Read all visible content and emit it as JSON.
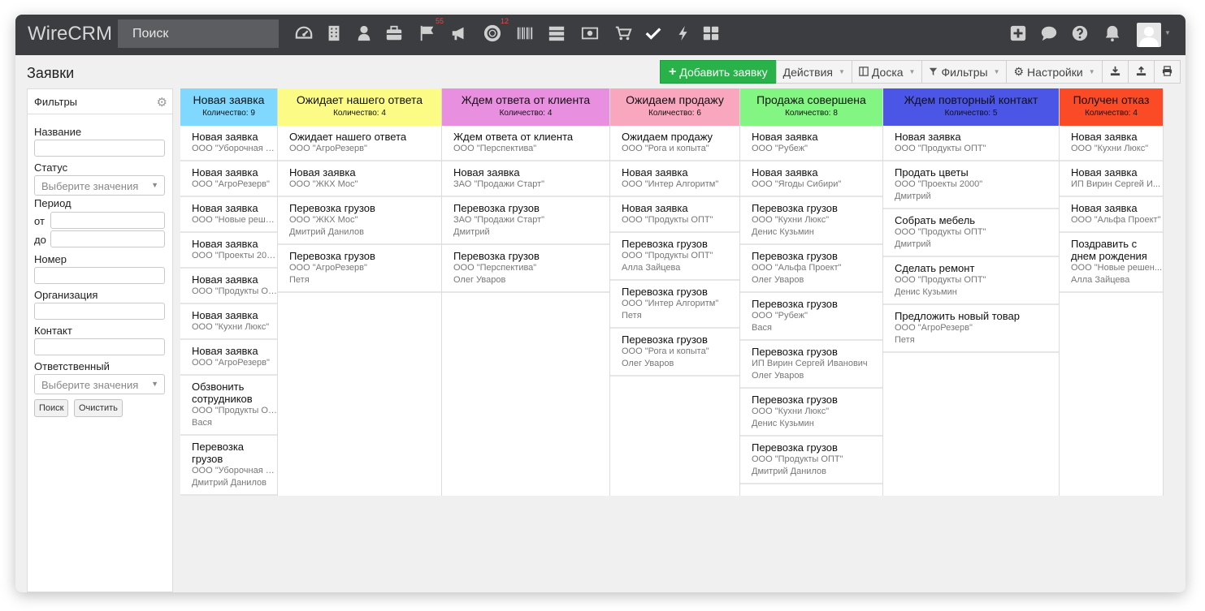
{
  "app": {
    "logo": "WireCRM",
    "search_placeholder": "Поиск"
  },
  "nav": {
    "icons": [
      {
        "name": "dashboard-icon"
      },
      {
        "name": "building-icon"
      },
      {
        "name": "user-icon"
      },
      {
        "name": "briefcase-icon"
      },
      {
        "name": "flag-icon",
        "badge": "55"
      },
      {
        "name": "megaphone-icon"
      },
      {
        "name": "lifebuoy-icon",
        "badge": "12"
      },
      {
        "name": "barcode-icon"
      },
      {
        "name": "server-icon"
      },
      {
        "name": "money-icon"
      },
      {
        "name": "cart-icon"
      },
      {
        "name": "check-icon"
      },
      {
        "name": "bolt-icon"
      },
      {
        "name": "grid-icon"
      }
    ],
    "right_icons": [
      "plus-square-icon",
      "chat-icon",
      "help-icon",
      "bell-icon"
    ]
  },
  "page": {
    "title": "Заявки"
  },
  "toolbar": {
    "add_label": "Добавить заявку",
    "actions_label": "Действия",
    "board_label": "Доска",
    "filters_label": "Фильтры",
    "settings_label": "Настройки"
  },
  "filters": {
    "header": "Фильтры",
    "name_label": "Название",
    "status_label": "Статус",
    "status_placeholder": "Выберите значения",
    "period_label": "Период",
    "from_label": "от",
    "to_label": "до",
    "number_label": "Номер",
    "org_label": "Организация",
    "contact_label": "Контакт",
    "responsible_label": "Ответственный",
    "responsible_placeholder": "Выберите значения",
    "search_button": "Поиск",
    "clear_button": "Очистить"
  },
  "columns": [
    {
      "title": "Новая заявка",
      "count": "Количество: 9",
      "color": "#80d8ff",
      "cards": [
        {
          "title": "Новая заявка",
          "org": "ООО \"Уборочная Ко...",
          "person": ""
        },
        {
          "title": "Новая заявка",
          "org": "ООО \"АгроРезерв\"",
          "person": ""
        },
        {
          "title": "Новая заявка",
          "org": "ООО \"Новые решен...",
          "person": ""
        },
        {
          "title": "Новая заявка",
          "org": "ООО \"Проекты 2000\"",
          "person": ""
        },
        {
          "title": "Новая заявка",
          "org": "ООО \"Продукты ОПТ\"",
          "person": ""
        },
        {
          "title": "Новая заявка",
          "org": "ООО \"Кухни Люкс\"",
          "person": ""
        },
        {
          "title": "Новая заявка",
          "org": "ООО \"АгроРезерв\"",
          "person": ""
        },
        {
          "title": "Обзвонить сотрудников",
          "org": "ООО \"Продукты ОПТ\"",
          "person": "Вася"
        },
        {
          "title": "Перевозка грузов",
          "org": "ООО \"Уборочная Ко...",
          "person": "Дмитрий Данилов"
        }
      ]
    },
    {
      "title": "Ожидает нашего ответа",
      "count": "Количество: 4",
      "color": "#fbfb85",
      "cards": [
        {
          "title": "Ожидает нашего ответа",
          "org": "ООО \"АгроРезерв\"",
          "person": ""
        },
        {
          "title": "Новая заявка",
          "org": "ООО \"ЖКХ Мос\"",
          "person": ""
        },
        {
          "title": "Перевозка грузов",
          "org": "ООО \"ЖКХ Мос\"",
          "person": "Дмитрий Данилов"
        },
        {
          "title": "Перевозка грузов",
          "org": "ООО \"АгроРезерв\"",
          "person": "Петя"
        }
      ]
    },
    {
      "title": "Ждем ответа от клиента",
      "count": "Количество: 4",
      "color": "#e98fdf",
      "cards": [
        {
          "title": "Ждем ответа от клиента",
          "org": "ООО \"Перспектива\"",
          "person": ""
        },
        {
          "title": "Новая заявка",
          "org": "ЗАО \"Продажи Старт\"",
          "person": ""
        },
        {
          "title": "Перевозка грузов",
          "org": "ЗАО \"Продажи Старт\"",
          "person": "Дмитрий"
        },
        {
          "title": "Перевозка грузов",
          "org": "ООО \"Перспектива\"",
          "person": "Олег Уваров"
        }
      ]
    },
    {
      "title": "Ожидаем продажу",
      "count": "Количество: 6",
      "color": "#f8a7bf",
      "cards": [
        {
          "title": "Ожидаем продажу",
          "org": "ООО \"Рога и копыта\"",
          "person": ""
        },
        {
          "title": "Новая заявка",
          "org": "ООО \"Интер Алгоритм\"",
          "person": ""
        },
        {
          "title": "Новая заявка",
          "org": "ООО \"Продукты ОПТ\"",
          "person": ""
        },
        {
          "title": "Перевозка грузов",
          "org": "ООО \"Продукты ОПТ\"",
          "person": "Алла Зайцева"
        },
        {
          "title": "Перевозка грузов",
          "org": "ООО \"Интер Алгоритм\"",
          "person": "Петя"
        },
        {
          "title": "Перевозка грузов",
          "org": "ООО \"Рога и копыта\"",
          "person": "Олег Уваров"
        }
      ]
    },
    {
      "title": "Продажа совершена",
      "count": "Количество: 8",
      "color": "#82f582",
      "cards": [
        {
          "title": "Новая заявка",
          "org": "ООО \"Рубеж\"",
          "person": ""
        },
        {
          "title": "Новая заявка",
          "org": "ООО \"Ягоды Сибири\"",
          "person": ""
        },
        {
          "title": "Перевозка грузов",
          "org": "ООО \"Кухни Люкс\"",
          "person": "Денис Кузьмин"
        },
        {
          "title": "Перевозка грузов",
          "org": "ООО \"Альфа Проект\"",
          "person": "Олег Уваров"
        },
        {
          "title": "Перевозка грузов",
          "org": "ООО \"Рубеж\"",
          "person": "Вася"
        },
        {
          "title": "Перевозка грузов",
          "org": "ИП Вирин Сергей Иванович",
          "person": "Олег Уваров"
        },
        {
          "title": "Перевозка грузов",
          "org": "ООО \"Кухни Люкс\"",
          "person": "Денис Кузьмин"
        },
        {
          "title": "Перевозка грузов",
          "org": "ООО \"Продукты ОПТ\"",
          "person": "Дмитрий Данилов"
        }
      ]
    },
    {
      "title": "Ждем повторный контакт",
      "count": "Количество: 5",
      "color": "#4b55e6",
      "cards": [
        {
          "title": "Новая заявка",
          "org": "ООО \"Продукты ОПТ\"",
          "person": ""
        },
        {
          "title": "Продать цветы",
          "org": "ООО \"Проекты 2000\"",
          "person": "Дмитрий"
        },
        {
          "title": "Собрать мебель",
          "org": "ООО \"Продукты ОПТ\"",
          "person": "Дмитрий"
        },
        {
          "title": "Сделать ремонт",
          "org": "ООО \"Продукты ОПТ\"",
          "person": "Денис Кузьмин"
        },
        {
          "title": "Предложить новый товар",
          "org": "ООО \"АгроРезерв\"",
          "person": "Петя"
        }
      ]
    },
    {
      "title": "Получен отказ",
      "count": "Количество: 4",
      "color": "#fb4a26",
      "cards": [
        {
          "title": "Новая заявка",
          "org": "ООО \"Кухни Люкс\"",
          "person": ""
        },
        {
          "title": "Новая заявка",
          "org": "ИП Вирин Сергей И...",
          "person": ""
        },
        {
          "title": "Новая заявка",
          "org": "ООО \"Альфа Проект\"",
          "person": ""
        },
        {
          "title": "Поздравить с днем рождения",
          "org": "ООО \"Новые решен...",
          "person": "Алла Зайцева"
        }
      ]
    }
  ]
}
